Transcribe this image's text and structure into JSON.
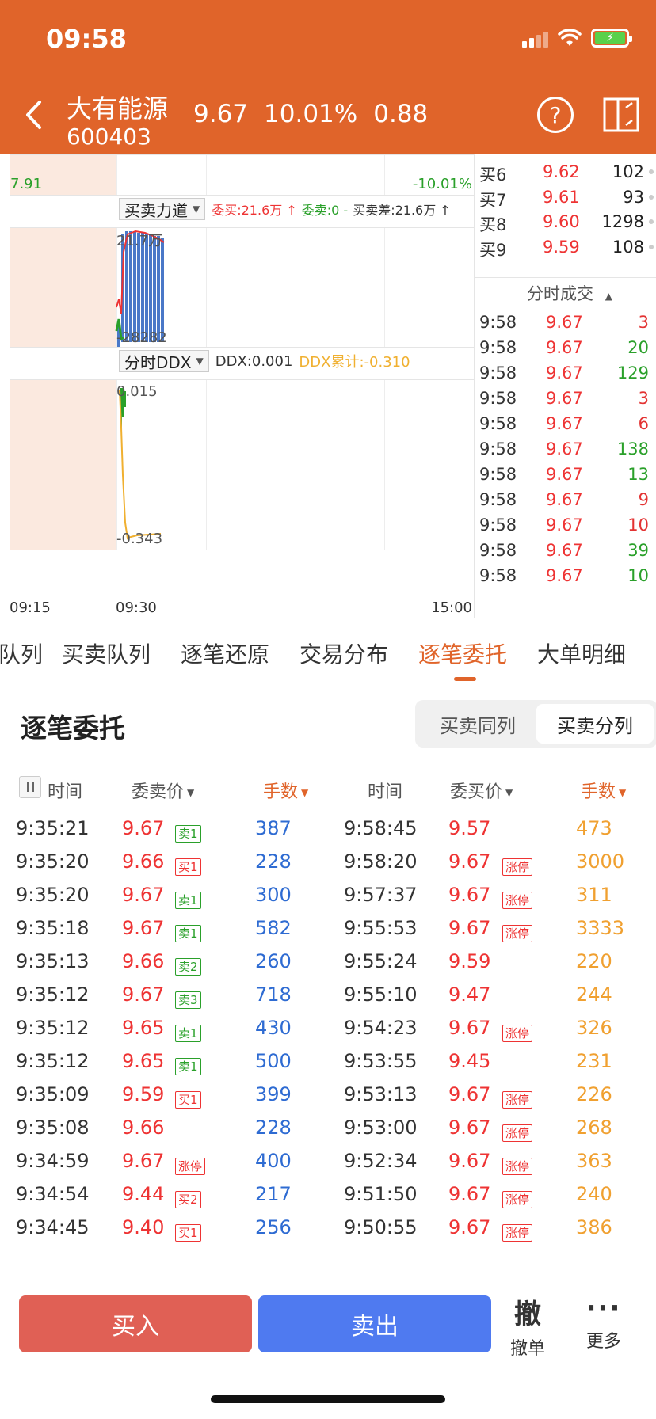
{
  "status": {
    "time": "09:58"
  },
  "header": {
    "name": "大有能源",
    "code": "600403",
    "price": "9.67",
    "change_pct": "10.01%",
    "change": "0.88",
    "help": "?"
  },
  "chart": {
    "top_left_value": "7.91",
    "top_right_pct": "-10.01%",
    "ind1": {
      "select": "买卖力道",
      "buy_text": "委买:21.6万 ↑",
      "sell_text": "委卖:0 -",
      "diff_text": "买卖差:21.6万 ↑",
      "max_label": "21.7万",
      "min_label": "-28282"
    },
    "ind2": {
      "select": "分时DDX",
      "ddx_text": "DDX:0.001",
      "ddx_cum_text": "DDX累计:-0.310",
      "max_label": "0.015",
      "min_label": "-0.343"
    },
    "time_axis": [
      "09:15",
      "09:30",
      "15:00"
    ]
  },
  "orderbook": {
    "bids": [
      {
        "label": "买6",
        "price": "9.62",
        "vol": "102"
      },
      {
        "label": "买7",
        "price": "9.61",
        "vol": "93"
      },
      {
        "label": "买8",
        "price": "9.60",
        "vol": "1298"
      },
      {
        "label": "买9",
        "price": "9.59",
        "vol": "108"
      }
    ],
    "trades_title": "分时成交",
    "trades": [
      {
        "time": "9:58",
        "price": "9.67",
        "vol": "3",
        "color": "#e33333"
      },
      {
        "time": "9:58",
        "price": "9.67",
        "vol": "20",
        "color": "#2aa02a"
      },
      {
        "time": "9:58",
        "price": "9.67",
        "vol": "129",
        "color": "#2aa02a"
      },
      {
        "time": "9:58",
        "price": "9.67",
        "vol": "3",
        "color": "#e33333"
      },
      {
        "time": "9:58",
        "price": "9.67",
        "vol": "6",
        "color": "#e33333"
      },
      {
        "time": "9:58",
        "price": "9.67",
        "vol": "138",
        "color": "#2aa02a"
      },
      {
        "time": "9:58",
        "price": "9.67",
        "vol": "13",
        "color": "#2aa02a"
      },
      {
        "time": "9:58",
        "price": "9.67",
        "vol": "9",
        "color": "#e33333"
      },
      {
        "time": "9:58",
        "price": "9.67",
        "vol": "10",
        "color": "#e33333"
      },
      {
        "time": "9:58",
        "price": "9.67",
        "vol": "39",
        "color": "#2aa02a"
      },
      {
        "time": "9:58",
        "price": "9.67",
        "vol": "10",
        "color": "#2aa02a"
      }
    ]
  },
  "tabs": [
    "队列",
    "买卖队列",
    "逐笔还原",
    "交易分布",
    "逐笔委托",
    "大单明细"
  ],
  "active_tab": 4,
  "section": {
    "title": "逐笔委托",
    "seg_left": "买卖同列",
    "seg_right": "买卖分列"
  },
  "table_head": {
    "time": "时间",
    "sell_price": "委卖价",
    "sell_vol": "手数",
    "time2": "时间",
    "buy_price": "委买价",
    "buy_vol": "手数"
  },
  "rows": [
    {
      "st": "9:35:21",
      "sp": "9.67",
      "stag": "卖1",
      "stc": "green",
      "sv": "387",
      "bt": "9:58:45",
      "bp": "9.57",
      "btag": "",
      "bv": "473"
    },
    {
      "st": "9:35:20",
      "sp": "9.66",
      "stag": "买1",
      "stc": "red",
      "sv": "228",
      "bt": "9:58:20",
      "bp": "9.67",
      "btag": "涨停",
      "bv": "3000"
    },
    {
      "st": "9:35:20",
      "sp": "9.67",
      "stag": "卖1",
      "stc": "green",
      "sv": "300",
      "bt": "9:57:37",
      "bp": "9.67",
      "btag": "涨停",
      "bv": "311"
    },
    {
      "st": "9:35:18",
      "sp": "9.67",
      "stag": "卖1",
      "stc": "green",
      "sv": "582",
      "bt": "9:55:53",
      "bp": "9.67",
      "btag": "涨停",
      "bv": "3333"
    },
    {
      "st": "9:35:13",
      "sp": "9.66",
      "stag": "卖2",
      "stc": "green",
      "sv": "260",
      "bt": "9:55:24",
      "bp": "9.59",
      "btag": "",
      "bv": "220"
    },
    {
      "st": "9:35:12",
      "sp": "9.67",
      "stag": "卖3",
      "stc": "green",
      "sv": "718",
      "bt": "9:55:10",
      "bp": "9.47",
      "btag": "",
      "bv": "244"
    },
    {
      "st": "9:35:12",
      "sp": "9.65",
      "stag": "卖1",
      "stc": "green",
      "sv": "430",
      "bt": "9:54:23",
      "bp": "9.67",
      "btag": "涨停",
      "bv": "326"
    },
    {
      "st": "9:35:12",
      "sp": "9.65",
      "stag": "卖1",
      "stc": "green",
      "sv": "500",
      "bt": "9:53:55",
      "bp": "9.45",
      "btag": "",
      "bv": "231"
    },
    {
      "st": "9:35:09",
      "sp": "9.59",
      "stag": "买1",
      "stc": "red",
      "sv": "399",
      "bt": "9:53:13",
      "bp": "9.67",
      "btag": "涨停",
      "bv": "226"
    },
    {
      "st": "9:35:08",
      "sp": "9.66",
      "stag": "",
      "stc": "green",
      "sv": "228",
      "bt": "9:53:00",
      "bp": "9.67",
      "btag": "涨停",
      "bv": "268"
    },
    {
      "st": "9:34:59",
      "sp": "9.67",
      "stag": "涨停",
      "stc": "red",
      "sv": "400",
      "bt": "9:52:34",
      "bp": "9.67",
      "btag": "涨停",
      "bv": "363"
    },
    {
      "st": "9:34:54",
      "sp": "9.44",
      "stag": "买2",
      "stc": "red",
      "sv": "217",
      "bt": "9:51:50",
      "bp": "9.67",
      "btag": "涨停",
      "bv": "240"
    },
    {
      "st": "9:34:45",
      "sp": "9.40",
      "stag": "买1",
      "stc": "red",
      "sv": "256",
      "bt": "9:50:55",
      "bp": "9.67",
      "btag": "涨停",
      "bv": "386"
    }
  ],
  "bottom": {
    "buy": "买入",
    "sell": "卖出",
    "cancel_big": "撤",
    "cancel": "撤单",
    "more_dots": "···",
    "more": "更多"
  },
  "colors": {
    "brand": "#e0642a",
    "up": "#e33333",
    "down": "#2aa02a",
    "sell_vol": "#2e6bd2",
    "buy_vol": "#f0a030",
    "buy_btn": "#e06055",
    "sell_btn": "#4f7af0"
  }
}
